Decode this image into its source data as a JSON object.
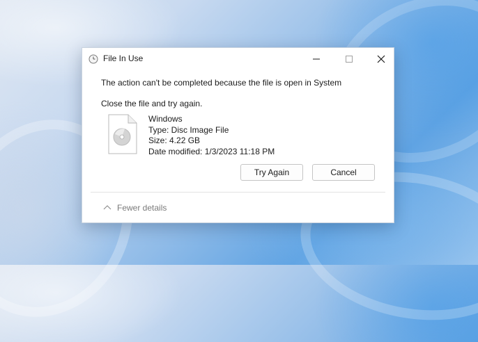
{
  "dialog": {
    "title": "File In Use",
    "title_icon": "clock-icon",
    "message": "The action can't be completed because the file is open in System",
    "instruction": "Close the file and try again.",
    "file": {
      "icon": "disc-image-file-icon",
      "name": "Windows",
      "type": "Type: Disc Image File",
      "size": "Size: 4.22 GB",
      "modified": "Date modified: 1/3/2023 11:18 PM"
    },
    "buttons": {
      "try_again": "Try Again",
      "cancel": "Cancel"
    },
    "details_toggle": "Fewer details"
  },
  "colors": {
    "dialog_bg": "#ffffff",
    "text": "#1b1b1b",
    "muted_text": "#7a7a7a",
    "button_border": "#c4c4c4",
    "wallpaper_accent": "#5fa3e3"
  }
}
